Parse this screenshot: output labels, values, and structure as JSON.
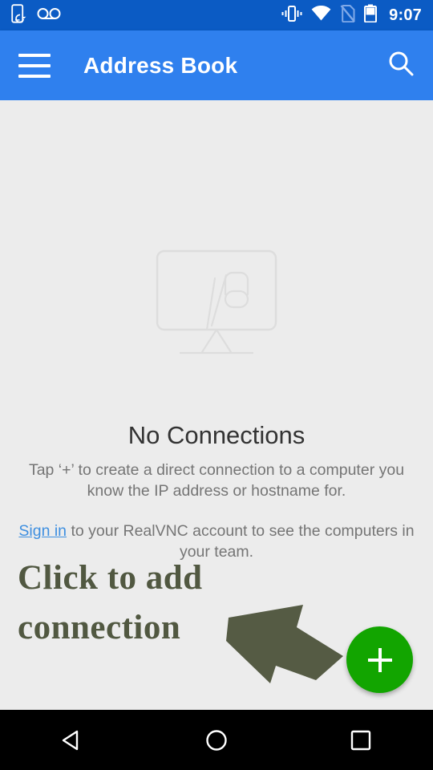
{
  "statusbar": {
    "time": "9:07",
    "icons_left": [
      "phone-sync-icon",
      "voicemail-icon"
    ],
    "icons_right": [
      "vibrate-icon",
      "wifi-icon",
      "no-sim-icon",
      "battery-icon"
    ],
    "background": "#0B5BC4"
  },
  "appbar": {
    "title": "Address Book",
    "menu_icon": "hamburger-menu-icon",
    "search_icon": "search-icon",
    "background": "#2F80EE",
    "text_color": "#FFFFFF"
  },
  "empty_state": {
    "logo": "vnc-monitor-logo",
    "title": "No Connections",
    "description": "Tap ‘+’ to create a direct connection to a computer you know the IP address or hostname for.",
    "signin_link": "Sign in",
    "signin_rest": " to your RealVNC account to see the computers in your team.",
    "link_color": "#3E8FE0",
    "text_color": "#757575",
    "title_color": "#333333",
    "background": "#ECECEC"
  },
  "annotation": {
    "text": "Click to add connection",
    "color": "#515841",
    "arrow_icon": "arrow-pointing-right-down"
  },
  "fab": {
    "label": "+",
    "name": "add-connection-button",
    "color": "#12A500",
    "icon_color": "#FFFFFF"
  },
  "navbar": {
    "back": "back-triangle-icon",
    "home": "home-circle-icon",
    "recents": "recents-square-icon",
    "background": "#000000"
  }
}
